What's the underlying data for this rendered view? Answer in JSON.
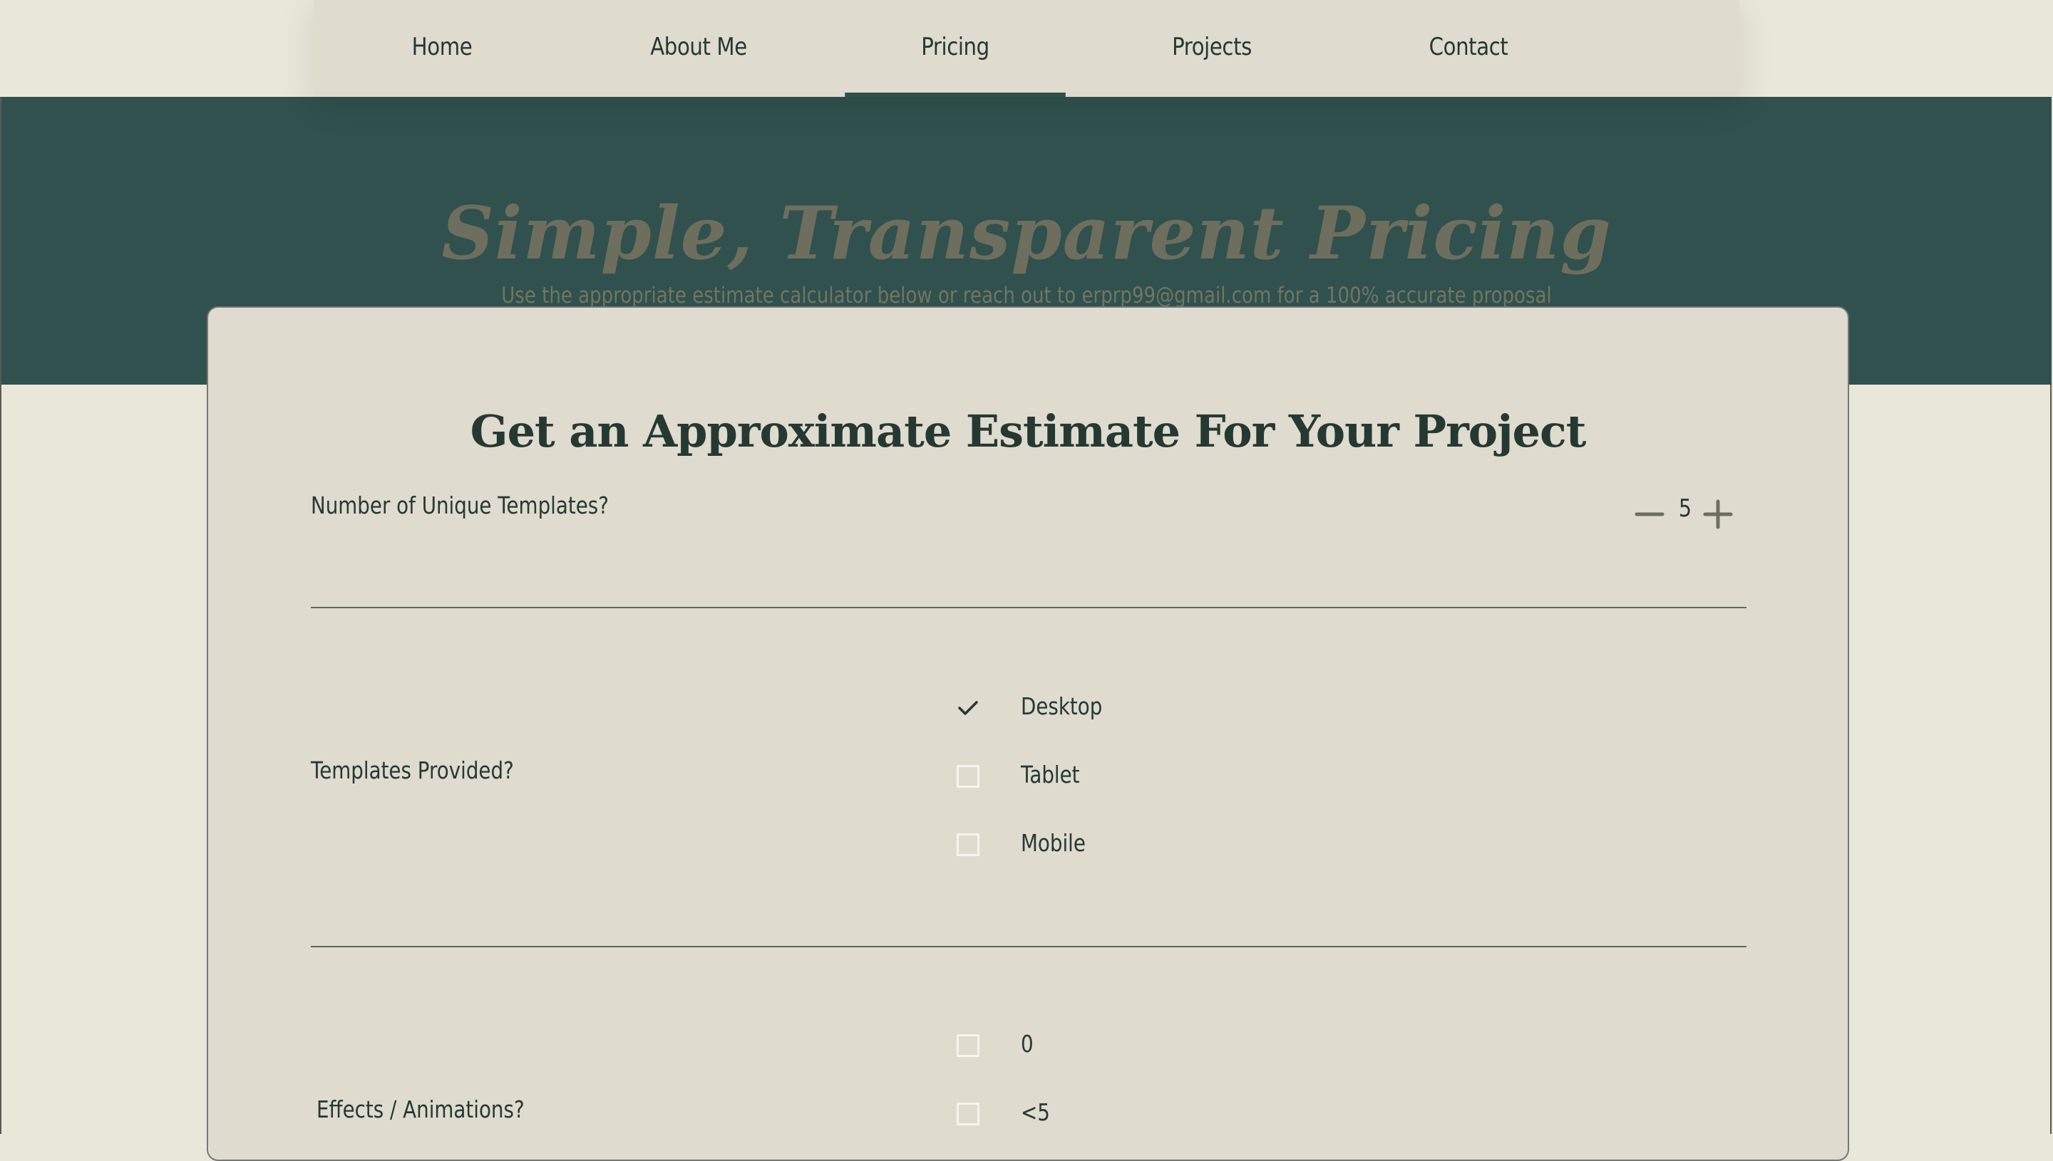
{
  "nav": {
    "items": [
      {
        "label": "Home"
      },
      {
        "label": "About Me"
      },
      {
        "label": "Pricing",
        "active": true
      },
      {
        "label": "Projects"
      },
      {
        "label": "Contact"
      }
    ]
  },
  "hero": {
    "title": "Simple, Transparent Pricing",
    "subtitle": "Use the appropriate estimate calculator below or reach out to erprp99@gmail.com for a 100% accurate proposal"
  },
  "estimator": {
    "title": "Get an Approximate Estimate For Your Project",
    "templates_question": {
      "label": "Number of Unique Templates?",
      "value": "5"
    },
    "templates_provided": {
      "label": "Templates Provided?",
      "options": [
        {
          "label": "Desktop",
          "checked": true
        },
        {
          "label": "Tablet",
          "checked": false
        },
        {
          "label": "Mobile",
          "checked": false
        }
      ]
    },
    "effects": {
      "label": "Effects / Animations?",
      "options": [
        {
          "label": "0",
          "checked": false
        },
        {
          "label": "<5",
          "checked": false
        }
      ]
    }
  },
  "colors": {
    "page_bg": "#e9e6da",
    "nav_bg": "#dfdbcf",
    "hero_bg": "#30514d",
    "hero_title": "#6e6e5e",
    "text_dark": "#263832",
    "card_bg": "#dfdbcf"
  },
  "icons": {
    "minus": "minus-icon",
    "plus": "plus-icon",
    "check": "check-icon"
  }
}
